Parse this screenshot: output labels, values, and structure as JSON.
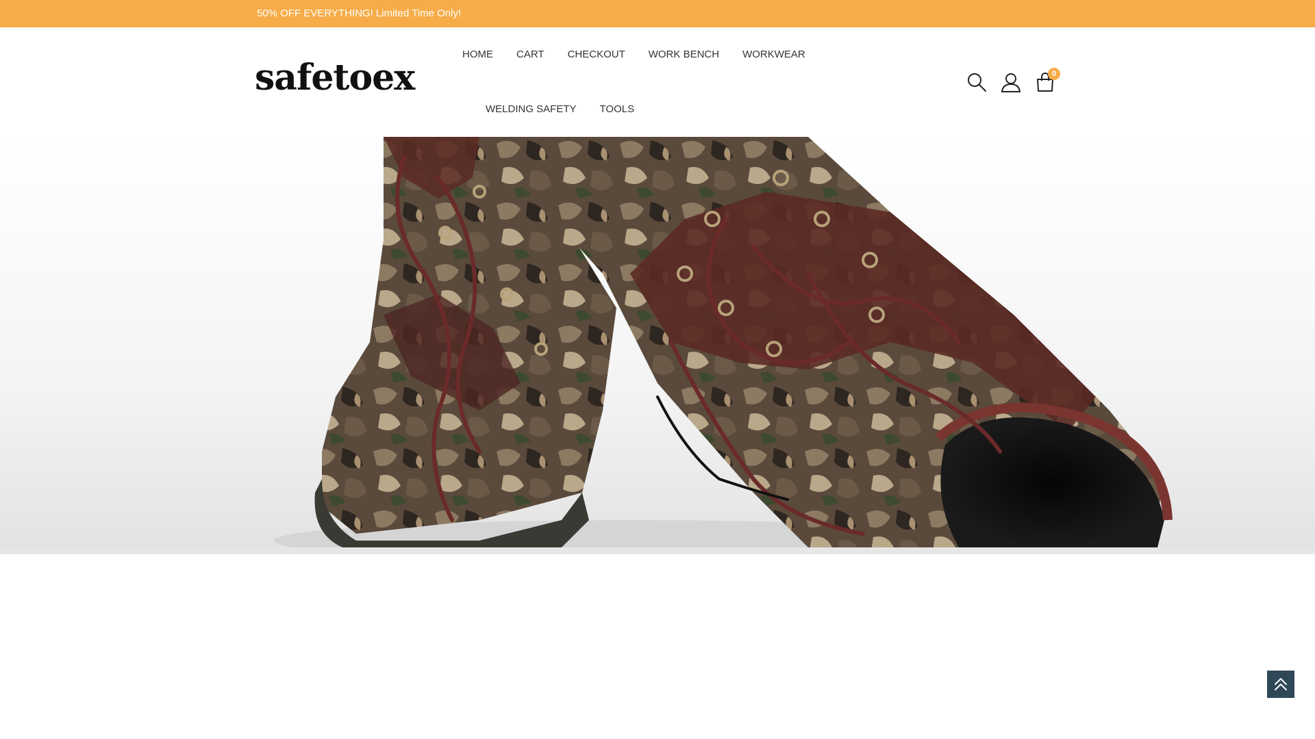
{
  "announcement": {
    "text": "50% OFF EVERYTHING! Limited Time Only!"
  },
  "brand": {
    "logo_text": "safetoex"
  },
  "nav": {
    "row1": [
      {
        "label": "HOME"
      },
      {
        "label": "CART"
      },
      {
        "label": "CHECKOUT"
      },
      {
        "label": "WORK BENCH"
      },
      {
        "label": "WORKWEAR"
      }
    ],
    "row2": [
      {
        "label": "WELDING SAFETY"
      },
      {
        "label": "TOOLS"
      }
    ]
  },
  "header_icons": {
    "search": "search-icon",
    "account": "user-icon",
    "cart": "shopping-bag-icon",
    "cart_count": "0"
  },
  "hero": {
    "image": "camouflage-work-boots-photo"
  },
  "back_to_top": {
    "icon": "double-chevron-up-icon"
  },
  "colors": {
    "accent": "#f6ac48",
    "back_to_top_bg": "#2f4858",
    "nav_text": "#333333"
  }
}
